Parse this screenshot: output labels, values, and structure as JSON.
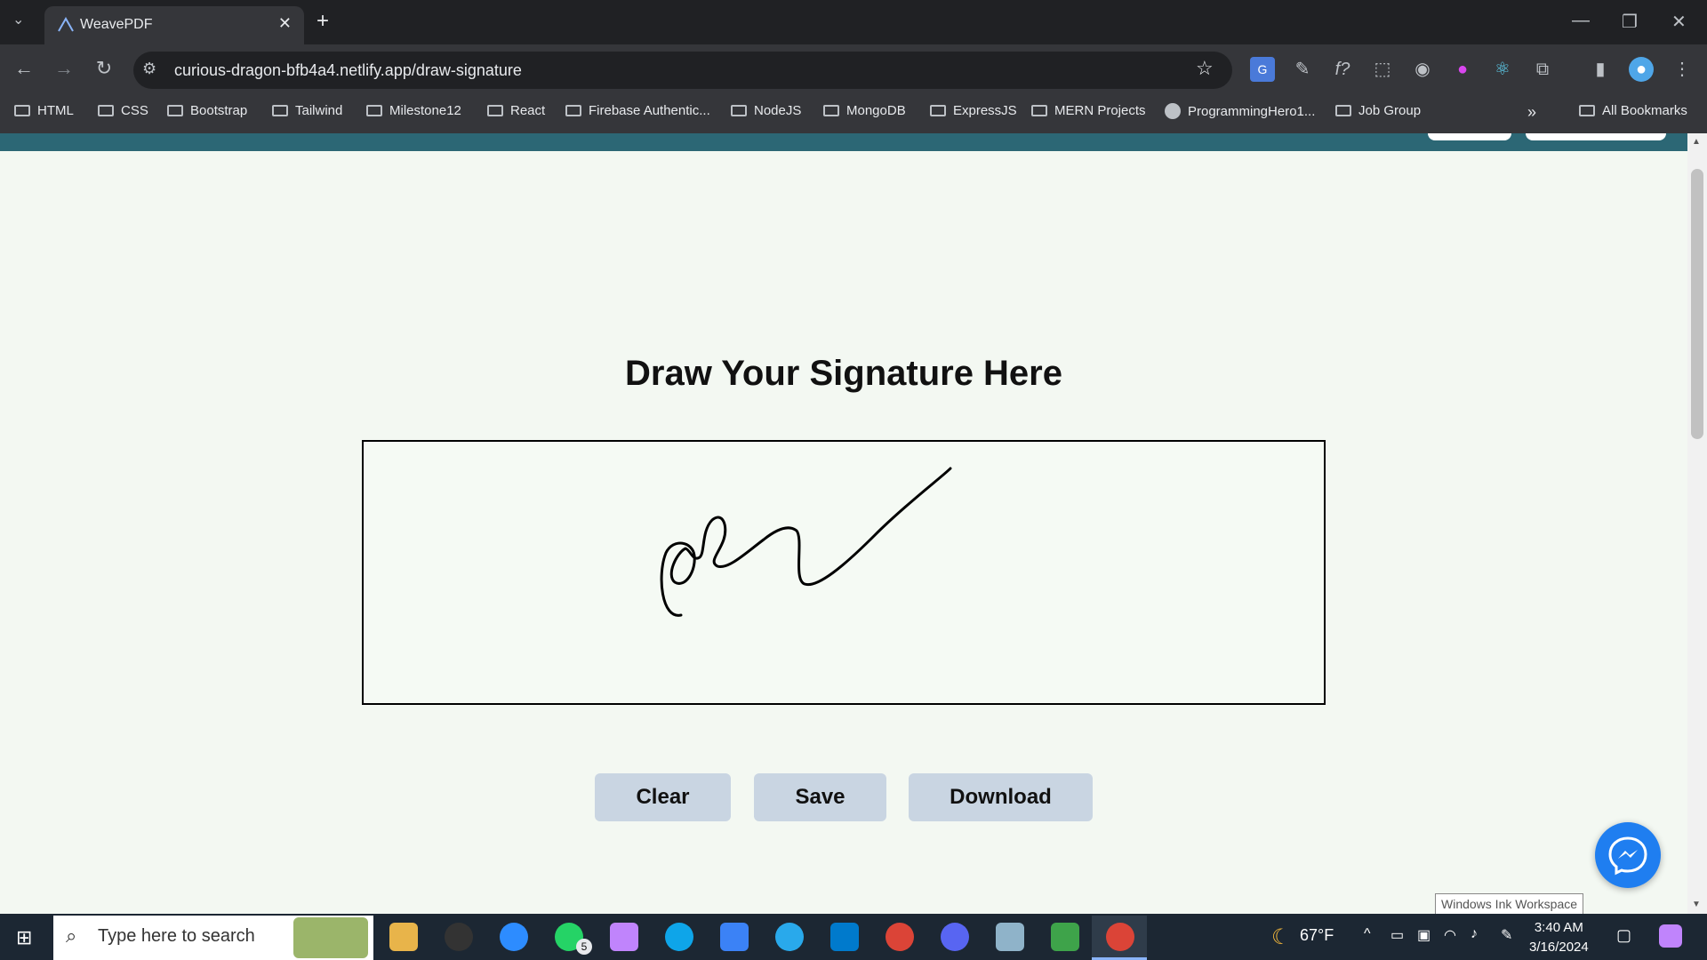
{
  "browser": {
    "tab_title": "WeavePDF",
    "url": "curious-dragon-bfb4a4.netlify.app/draw-signature",
    "bookmarks": [
      "HTML",
      "CSS",
      "Bootstrap",
      "Tailwind",
      "Milestone12",
      "React",
      "Firebase Authentic...",
      "NodeJS",
      "MongoDB",
      "ExpressJS",
      "MERN Projects",
      "ProgrammingHero1...",
      "Job Group"
    ],
    "all_bookmarks": "All Bookmarks"
  },
  "page": {
    "heading": "Draw Your Signature Here",
    "buttons": {
      "clear": "Clear",
      "save": "Save",
      "download": "Download"
    }
  },
  "tooltip": "Windows Ink Workspace",
  "taskbar": {
    "search_placeholder": "Type here to search",
    "weather": "67°F",
    "time": "3:40 AM",
    "date": "3/16/2024",
    "whatsapp_badge": "5"
  },
  "colors": {
    "header": "#2c6775",
    "button": "#c9d5e2",
    "messenger": "#1f7ef0"
  }
}
